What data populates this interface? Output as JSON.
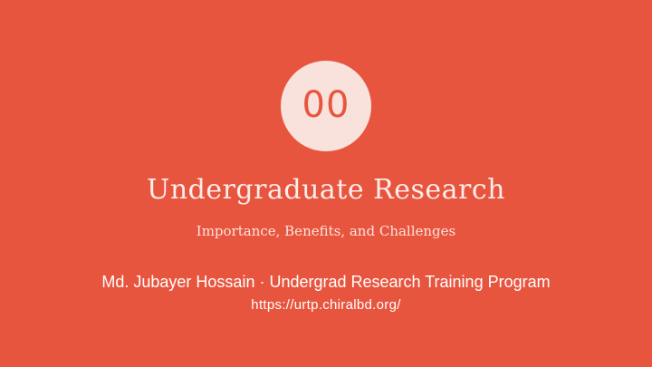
{
  "slide": {
    "number": "00",
    "title": "Undergraduate Research",
    "subtitle": "Importance, Benefits, and Challenges",
    "author_line": "Md. Jubayer Hossain · Undergrad Research Training Program",
    "url": "https://urtp.chiralbd.org/"
  },
  "colors": {
    "background": "#E8553E",
    "badge": "#F9E1DC",
    "text": "#FFFFFF"
  }
}
